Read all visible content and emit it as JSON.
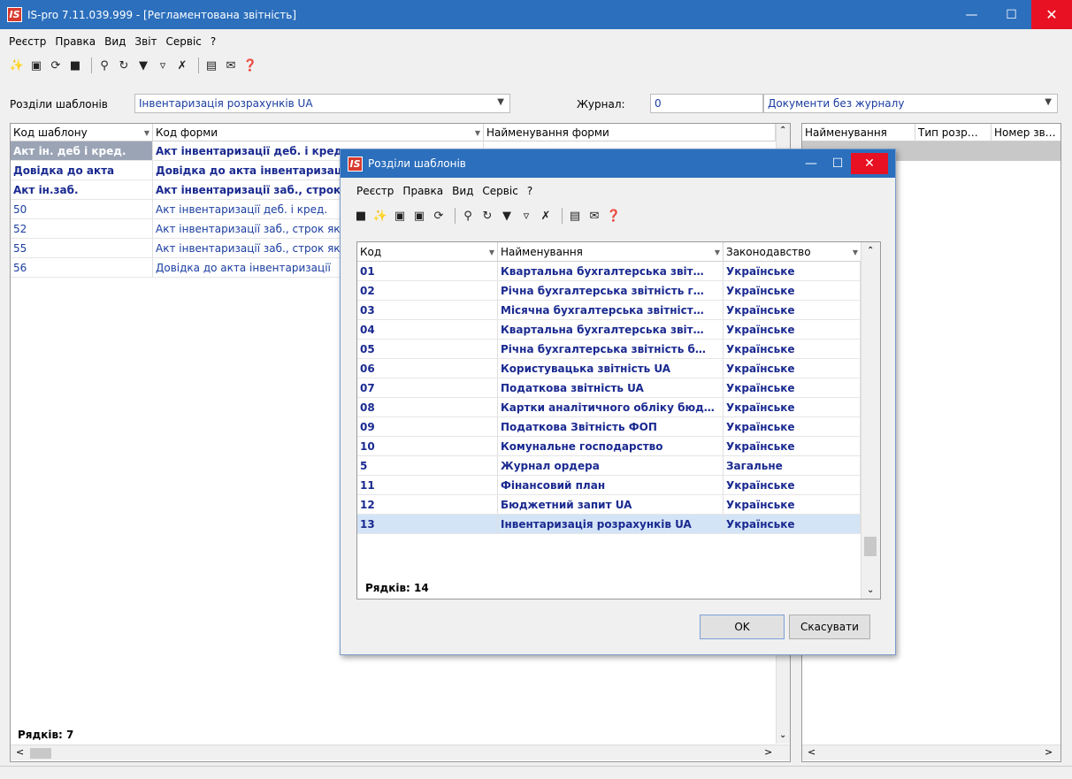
{
  "window": {
    "title": "IS-pro 7.11.039.999 - [Регламентована звітність]",
    "logo": "IS"
  },
  "menu": [
    "Реєстр",
    "Правка",
    "Вид",
    "Звіт",
    "Сервіс",
    "?"
  ],
  "filters": {
    "sections_label": "Розділи шаблонів",
    "sections_value": "Інвентаризація розрахунків UA",
    "journal_label": "Журнал:",
    "journal_value": "0",
    "journal_name": "Документи без журналу"
  },
  "left_table": {
    "columns": [
      "Код шаблону",
      "Код форми",
      "Найменування форми"
    ],
    "rows": [
      {
        "code": "Акт ін. деб і кред.",
        "form": "Акт інвентаризації деб. і кред."
      },
      {
        "code": "Довідка до акта",
        "form": "Довідка до акта інвентаризації"
      },
      {
        "code": "Акт ін.заб.",
        "form": "Акт інвентаризації заб., строк"
      },
      {
        "code": "50",
        "form": "Акт інвентаризації деб. і кред."
      },
      {
        "code": "52",
        "form": "Акт інвентаризації заб., строк як"
      },
      {
        "code": "55",
        "form": "Акт інвентаризації заб., строк як"
      },
      {
        "code": "56",
        "form": "Довідка до акта інвентаризації"
      }
    ],
    "footer": "Рядків: 7"
  },
  "right_table": {
    "columns": [
      "Найменування",
      "Тип розр…",
      "Номер зв…"
    ]
  },
  "dialog": {
    "title": "Розділи шаблонів",
    "menu": [
      "Реєстр",
      "Правка",
      "Вид",
      "Сервіс",
      "?"
    ],
    "columns": [
      "Код",
      "Найменування",
      "Законодавство"
    ],
    "rows": [
      {
        "code": "01",
        "name": "Квартальна бухгалтерська звіт…",
        "law": "Українське"
      },
      {
        "code": "02",
        "name": "Річна бухгалтерська звітність г…",
        "law": "Українське"
      },
      {
        "code": "03",
        "name": "Місячна бухгалтерська звітніст…",
        "law": "Українське"
      },
      {
        "code": "04",
        "name": "Квартальна бухгалтерська звіт…",
        "law": "Українське"
      },
      {
        "code": "05",
        "name": "Річна бухгалтерська звітність б…",
        "law": "Українське"
      },
      {
        "code": "06",
        "name": "Користувацька звітність UA",
        "law": "Українське"
      },
      {
        "code": "07",
        "name": "Податкова звітність UA",
        "law": "Українське"
      },
      {
        "code": "08",
        "name": "Картки аналітичного обліку бюд…",
        "law": "Українське"
      },
      {
        "code": "09",
        "name": "Податкова Звітність ФОП",
        "law": "Українське"
      },
      {
        "code": "10",
        "name": "Комунальне господарство",
        "law": "Українське"
      },
      {
        "code": "5",
        "name": "Журнал ордера",
        "law": "Загальне"
      },
      {
        "code": "11",
        "name": "Фінансовий план",
        "law": "Українське"
      },
      {
        "code": "12",
        "name": "Бюджетний запит UA",
        "law": "Українське"
      },
      {
        "code": "13",
        "name": "Інвентаризація розрахунків UA",
        "law": "Українське"
      }
    ],
    "footer": "Рядків: 14",
    "ok": "OK",
    "cancel": "Скасувати"
  }
}
